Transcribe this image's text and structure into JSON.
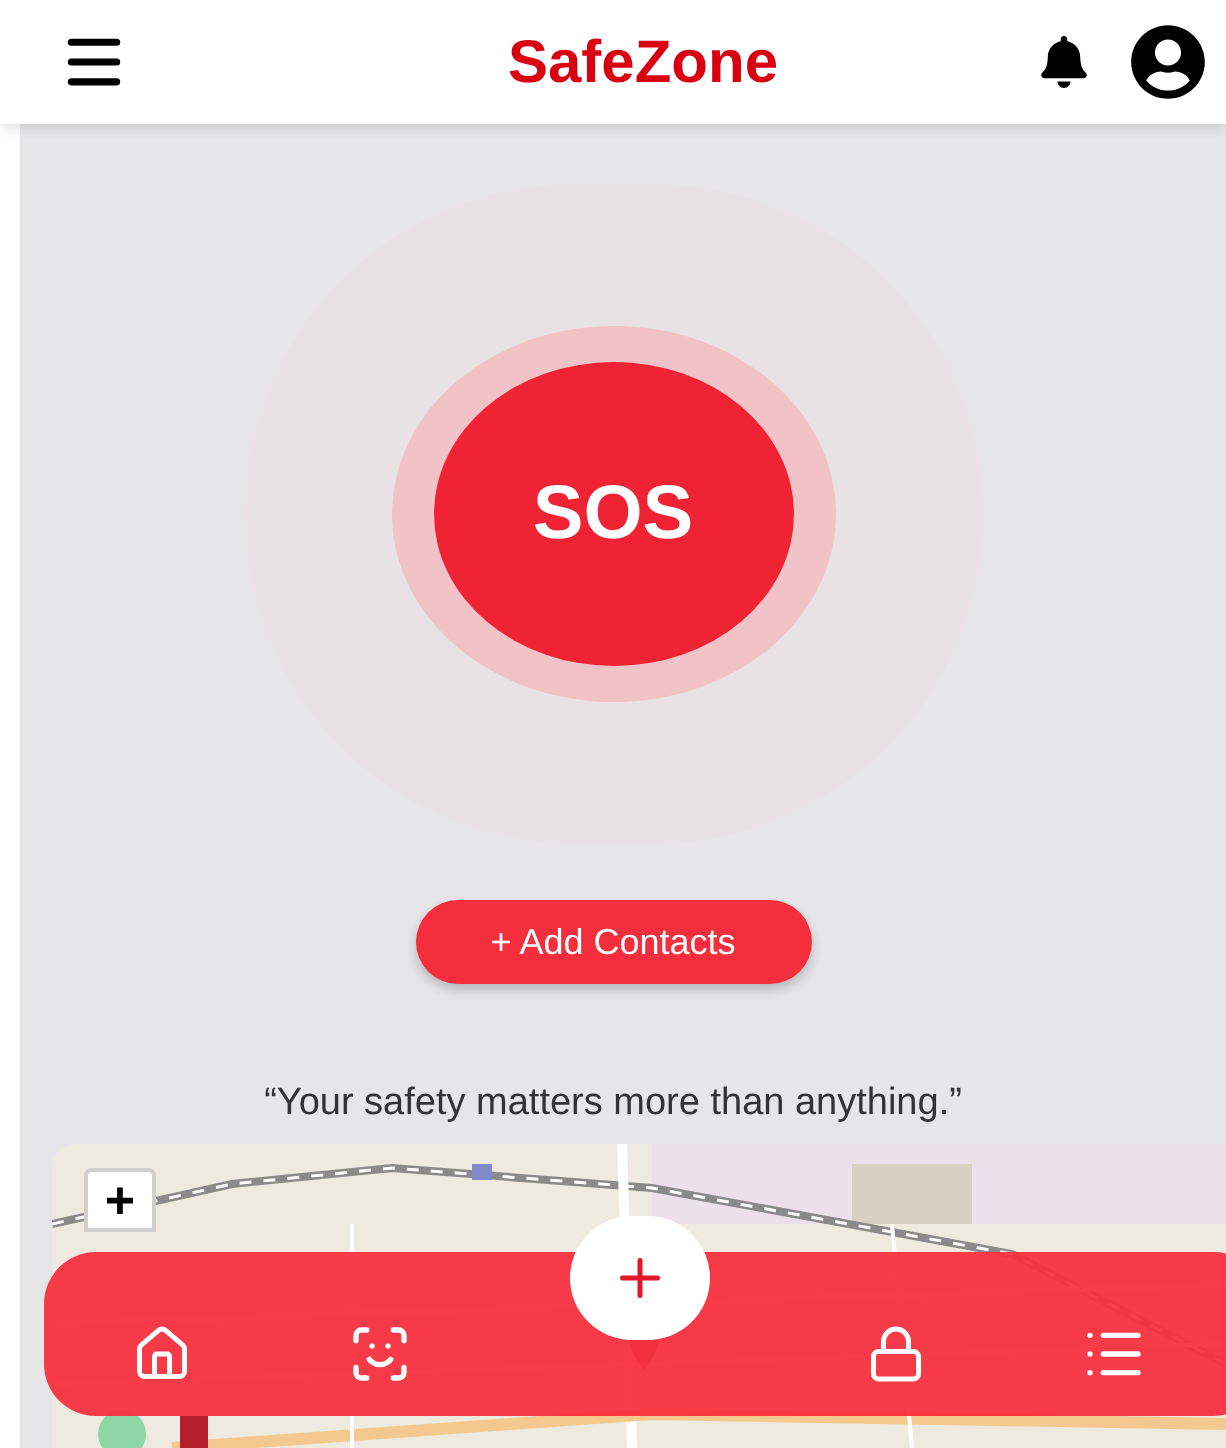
{
  "header": {
    "title": "SafeZone"
  },
  "sos": {
    "label": "SOS"
  },
  "add_contacts": {
    "label": "+ Add Contacts"
  },
  "quote": "“Your safety matters more than anything.”",
  "map": {
    "kind": "picture",
    "zoom_in": "+"
  }
}
